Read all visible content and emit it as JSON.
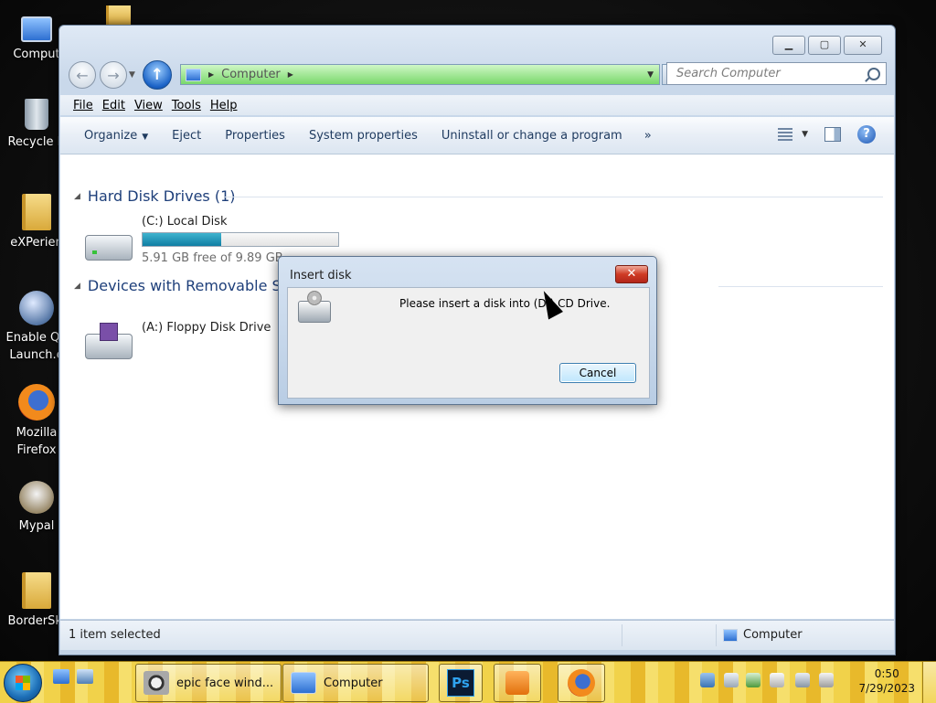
{
  "desktop": {
    "icons": [
      {
        "label": "Comput"
      },
      {
        "label": "Recycle B"
      },
      {
        "label": "eXPerien"
      },
      {
        "label": "Enable Qu\nLaunch.e"
      },
      {
        "label": "Mozilla\nFirefox"
      },
      {
        "label": "Mypal"
      },
      {
        "label": "BorderSki"
      }
    ]
  },
  "explorer": {
    "address": {
      "location": "Computer"
    },
    "search": {
      "placeholder": "Search Computer"
    },
    "menu": [
      "File",
      "Edit",
      "View",
      "Tools",
      "Help"
    ],
    "toolbar": {
      "organize": "Organize",
      "eject": "Eject",
      "properties": "Properties",
      "system_properties": "System properties",
      "uninstall": "Uninstall or change a program",
      "more": "»"
    },
    "groups": {
      "hard_disk": "Hard Disk Drives (1)",
      "removable": "Devices with Removable Sto"
    },
    "drives": {
      "c": {
        "name": "(C:) Local Disk",
        "free_text": "5.91 GB free of 9.89 GB",
        "used_fraction": 0.4
      },
      "a": {
        "name": "(A:) Floppy Disk Drive"
      }
    },
    "status": {
      "selection": "1 item selected",
      "location": "Computer"
    }
  },
  "dialog": {
    "title": "Insert disk",
    "message": "Please insert a disk into (D:) CD Drive.",
    "cancel": "Cancel"
  },
  "taskbar": {
    "tasks": [
      {
        "label": "epic face wind..."
      },
      {
        "label": "Computer"
      }
    ],
    "clock": {
      "time": "0:50",
      "date": "7/29/2023"
    }
  }
}
